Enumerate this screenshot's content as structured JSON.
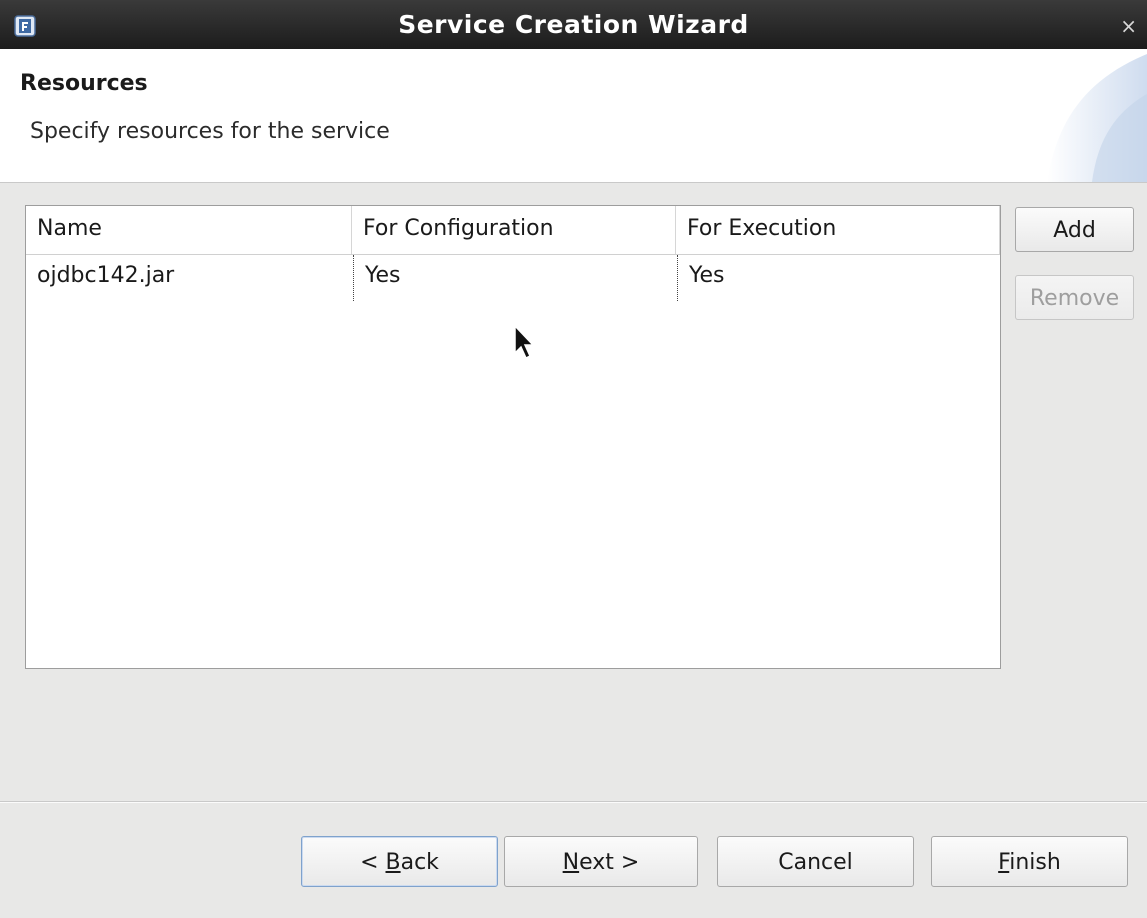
{
  "window": {
    "title": "Service Creation Wizard",
    "app_icon": "wizard-app-icon",
    "close_glyph": "×"
  },
  "header": {
    "heading": "Resources",
    "description": "Specify resources  for the service"
  },
  "table": {
    "columns": [
      "Name",
      "For Configuration",
      "For Execution"
    ],
    "rows": [
      [
        "ojdbc142.jar",
        "Yes",
        "Yes"
      ]
    ]
  },
  "side_buttons": {
    "add": {
      "label": "Add",
      "enabled": true
    },
    "remove": {
      "label": "Remove",
      "enabled": false
    }
  },
  "footer": {
    "back": {
      "prefix": "< ",
      "mnemonic": "B",
      "rest": "ack"
    },
    "next": {
      "mnemonic": "N",
      "rest": "ext >"
    },
    "cancel": {
      "label": "Cancel"
    },
    "finish": {
      "mnemonic": "F",
      "rest": "inish"
    }
  },
  "colors": {
    "titlebar": "#262626",
    "background": "#e8e8e7",
    "focus_border": "#7fa2cc"
  }
}
